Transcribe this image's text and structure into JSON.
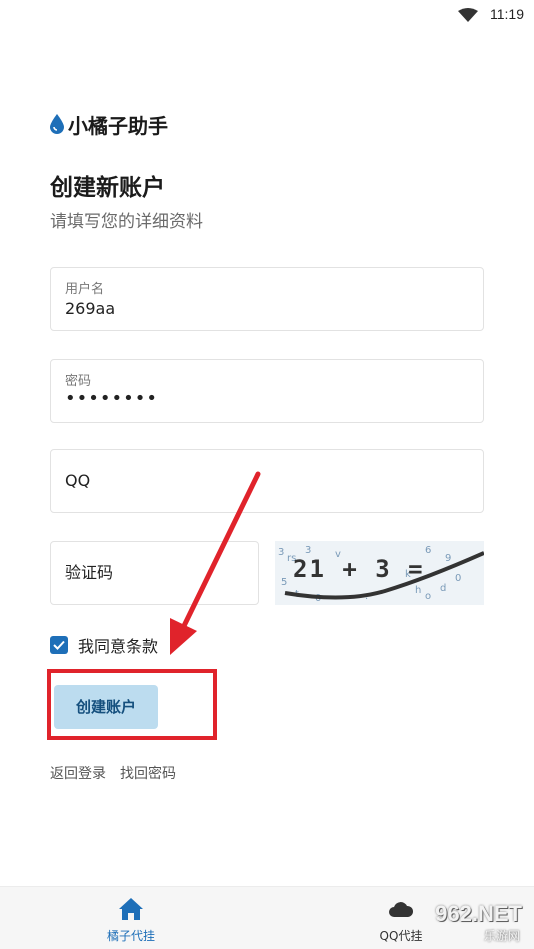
{
  "status_bar": {
    "time": "11:19"
  },
  "brand": {
    "name": "小橘子助手"
  },
  "header": {
    "title": "创建新账户",
    "subtitle": "请填写您的详细资料"
  },
  "form": {
    "username": {
      "label": "用户名",
      "value": "269aa"
    },
    "password": {
      "label": "密码",
      "value": "••••••••"
    },
    "qq": {
      "placeholder": "QQ"
    },
    "captcha": {
      "placeholder": "验证码",
      "image_text": "21 + 3 ="
    },
    "agree": {
      "label": "我同意条款",
      "checked": true
    },
    "submit_label": "创建账户"
  },
  "links": {
    "back_to_login": "返回登录",
    "recover_password": "找回密码"
  },
  "tabbar": {
    "tabs": [
      {
        "label": "橘子代挂",
        "icon": "home-icon",
        "active": true
      },
      {
        "label": "QQ代挂",
        "icon": "cloud-icon",
        "active": false
      }
    ]
  },
  "watermark": {
    "main": "962.NET",
    "sub": "乐游网"
  },
  "colors": {
    "accent": "#1e6fb8",
    "button_bg": "#bcdcef",
    "highlight": "#e0232b"
  }
}
